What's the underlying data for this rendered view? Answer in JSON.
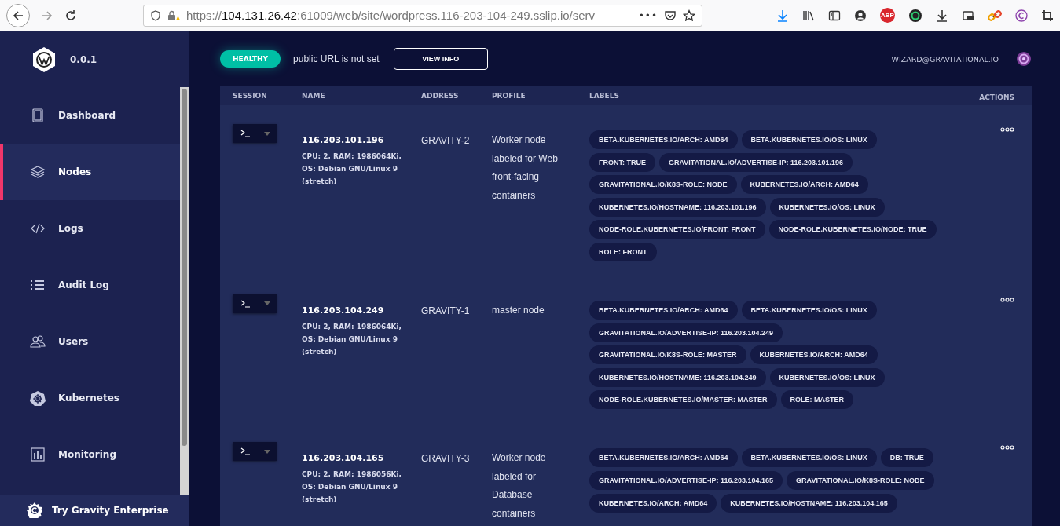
{
  "browser": {
    "url_scheme": "https://",
    "url_host": "104.131.26.42",
    "url_rest": ":61009/web/site/wordpress.116-203-104-249.sslip.io/serv",
    "more": "•••",
    "abp": "ABP"
  },
  "sidebar": {
    "version": "0.0.1",
    "items": [
      {
        "label": "Dashboard",
        "selected": false
      },
      {
        "label": "Nodes",
        "selected": true
      },
      {
        "label": "Logs",
        "selected": false
      },
      {
        "label": "Audit Log",
        "selected": false
      },
      {
        "label": "Users",
        "selected": false
      },
      {
        "label": "Kubernetes",
        "selected": false
      },
      {
        "label": "Monitoring",
        "selected": false
      }
    ],
    "footer": "Try Gravity Enterprise"
  },
  "header": {
    "status": "HEALTHY",
    "url_note": "public URL is not set",
    "view_button": "VIEW INFO",
    "user": "WIZARD@GRAVITATIONAL.IO"
  },
  "table": {
    "columns": [
      "SESSION",
      "NAME",
      "ADDRESS",
      "PROFILE",
      "LABELS",
      "ACTIONS"
    ],
    "rows": [
      {
        "name": "116.203.101.196",
        "specs": "CPU: 2, RAM: 1986064Ki, OS: Debian GNU/Linux 9 (stretch)",
        "address": "GRAVITY-2",
        "profile": "Worker node labeled for Web front-facing containers",
        "labels": [
          "BETA.KUBERNETES.IO/ARCH: AMD64",
          "BETA.KUBERNETES.IO/OS: LINUX",
          "FRONT: TRUE",
          "GRAVITATIONAL.IO/ADVERTISE-IP: 116.203.101.196",
          "GRAVITATIONAL.IO/K8S-ROLE: NODE",
          "KUBERNETES.IO/ARCH: AMD64",
          "KUBERNETES.IO/HOSTNAME: 116.203.101.196",
          "KUBERNETES.IO/OS: LINUX",
          "NODE-ROLE.KUBERNETES.IO/FRONT: FRONT",
          "NODE-ROLE.KUBERNETES.IO/NODE: TRUE",
          "ROLE: FRONT"
        ]
      },
      {
        "name": "116.203.104.249",
        "specs": "CPU: 2, RAM: 1986064Ki, OS: Debian GNU/Linux 9 (stretch)",
        "address": "GRAVITY-1",
        "profile": "master node",
        "labels": [
          "BETA.KUBERNETES.IO/ARCH: AMD64",
          "BETA.KUBERNETES.IO/OS: LINUX",
          "GRAVITATIONAL.IO/ADVERTISE-IP: 116.203.104.249",
          "GRAVITATIONAL.IO/K8S-ROLE: MASTER",
          "KUBERNETES.IO/ARCH: AMD64",
          "KUBERNETES.IO/HOSTNAME: 116.203.104.249",
          "KUBERNETES.IO/OS: LINUX",
          "NODE-ROLE.KUBERNETES.IO/MASTER: MASTER",
          "ROLE: MASTER"
        ]
      },
      {
        "name": "116.203.104.165",
        "specs": "CPU: 2, RAM: 1986056Ki, OS: Debian GNU/Linux 9 (stretch)",
        "address": "GRAVITY-3",
        "profile": "Worker node labeled for Database containers",
        "labels": [
          "BETA.KUBERNETES.IO/ARCH: AMD64",
          "BETA.KUBERNETES.IO/OS: LINUX",
          "DB: TRUE",
          "GRAVITATIONAL.IO/ADVERTISE-IP: 116.203.104.165",
          "GRAVITATIONAL.IO/K8S-ROLE: NODE",
          "KUBERNETES.IO/ARCH: AMD64",
          "KUBERNETES.IO/HOSTNAME: 116.203.104.165"
        ]
      }
    ]
  }
}
